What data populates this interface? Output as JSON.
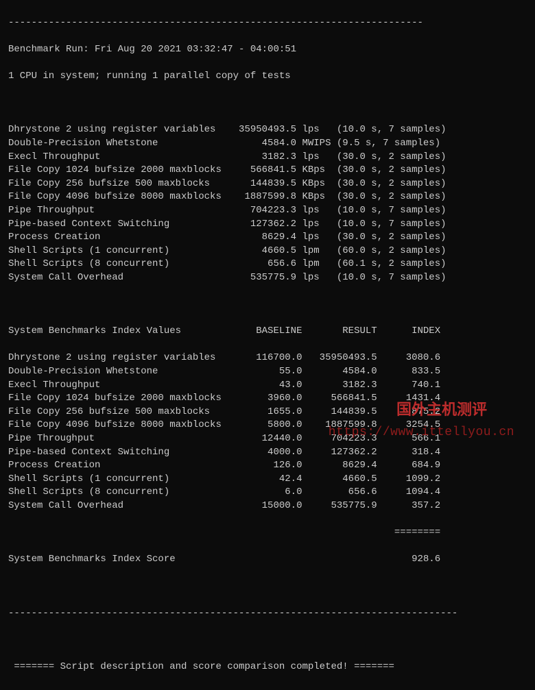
{
  "divider_top": "------------------------------------------------------------------------",
  "header": {
    "run_line": "Benchmark Run: Fri Aug 20 2021 03:32:47 - 04:00:51",
    "cpu_line": "1 CPU in system; running 1 parallel copy of tests"
  },
  "raw": {
    "rows": [
      {
        "name": "Dhrystone 2 using register variables",
        "value": "35950493.5",
        "unit": "lps",
        "timing": "(10.0 s, 7 samples)"
      },
      {
        "name": "Double-Precision Whetstone",
        "value": "4584.0",
        "unit": "MWIPS",
        "timing": "(9.5 s, 7 samples)"
      },
      {
        "name": "Execl Throughput",
        "value": "3182.3",
        "unit": "lps",
        "timing": "(30.0 s, 2 samples)"
      },
      {
        "name": "File Copy 1024 bufsize 2000 maxblocks",
        "value": "566841.5",
        "unit": "KBps",
        "timing": "(30.0 s, 2 samples)"
      },
      {
        "name": "File Copy 256 bufsize 500 maxblocks",
        "value": "144839.5",
        "unit": "KBps",
        "timing": "(30.0 s, 2 samples)"
      },
      {
        "name": "File Copy 4096 bufsize 8000 maxblocks",
        "value": "1887599.8",
        "unit": "KBps",
        "timing": "(30.0 s, 2 samples)"
      },
      {
        "name": "Pipe Throughput",
        "value": "704223.3",
        "unit": "lps",
        "timing": "(10.0 s, 7 samples)"
      },
      {
        "name": "Pipe-based Context Switching",
        "value": "127362.2",
        "unit": "lps",
        "timing": "(10.0 s, 7 samples)"
      },
      {
        "name": "Process Creation",
        "value": "8629.4",
        "unit": "lps",
        "timing": "(30.0 s, 2 samples)"
      },
      {
        "name": "Shell Scripts (1 concurrent)",
        "value": "4660.5",
        "unit": "lpm",
        "timing": "(60.0 s, 2 samples)"
      },
      {
        "name": "Shell Scripts (8 concurrent)",
        "value": "656.6",
        "unit": "lpm",
        "timing": "(60.1 s, 2 samples)"
      },
      {
        "name": "System Call Overhead",
        "value": "535775.9",
        "unit": "lps",
        "timing": "(10.0 s, 7 samples)"
      }
    ]
  },
  "index": {
    "header": {
      "name": "System Benchmarks Index Values",
      "baseline": "BASELINE",
      "result": "RESULT",
      "index": "INDEX"
    },
    "rows": [
      {
        "name": "Dhrystone 2 using register variables",
        "baseline": "116700.0",
        "result": "35950493.5",
        "index": "3080.6"
      },
      {
        "name": "Double-Precision Whetstone",
        "baseline": "55.0",
        "result": "4584.0",
        "index": "833.5"
      },
      {
        "name": "Execl Throughput",
        "baseline": "43.0",
        "result": "3182.3",
        "index": "740.1"
      },
      {
        "name": "File Copy 1024 bufsize 2000 maxblocks",
        "baseline": "3960.0",
        "result": "566841.5",
        "index": "1431.4"
      },
      {
        "name": "File Copy 256 bufsize 500 maxblocks",
        "baseline": "1655.0",
        "result": "144839.5",
        "index": "875.2"
      },
      {
        "name": "File Copy 4096 bufsize 8000 maxblocks",
        "baseline": "5800.0",
        "result": "1887599.8",
        "index": "3254.5"
      },
      {
        "name": "Pipe Throughput",
        "baseline": "12440.0",
        "result": "704223.3",
        "index": "566.1"
      },
      {
        "name": "Pipe-based Context Switching",
        "baseline": "4000.0",
        "result": "127362.2",
        "index": "318.4"
      },
      {
        "name": "Process Creation",
        "baseline": "126.0",
        "result": "8629.4",
        "index": "684.9"
      },
      {
        "name": "Shell Scripts (1 concurrent)",
        "baseline": "42.4",
        "result": "4660.5",
        "index": "1099.2"
      },
      {
        "name": "Shell Scripts (8 concurrent)",
        "baseline": "6.0",
        "result": "656.6",
        "index": "1094.4"
      },
      {
        "name": "System Call Overhead",
        "baseline": "15000.0",
        "result": "535775.9",
        "index": "357.2"
      }
    ],
    "sep": "                                                                   ========",
    "score": {
      "name": "System Benchmarks Index Score",
      "value": "928.6"
    }
  },
  "footer_divider": "------------------------------------------------------------------------------",
  "footer": " ======= Script description and score comparison completed! ======= ",
  "watermark1": "国外主机测评",
  "watermark2": "https://www.ittellyou.cn"
}
